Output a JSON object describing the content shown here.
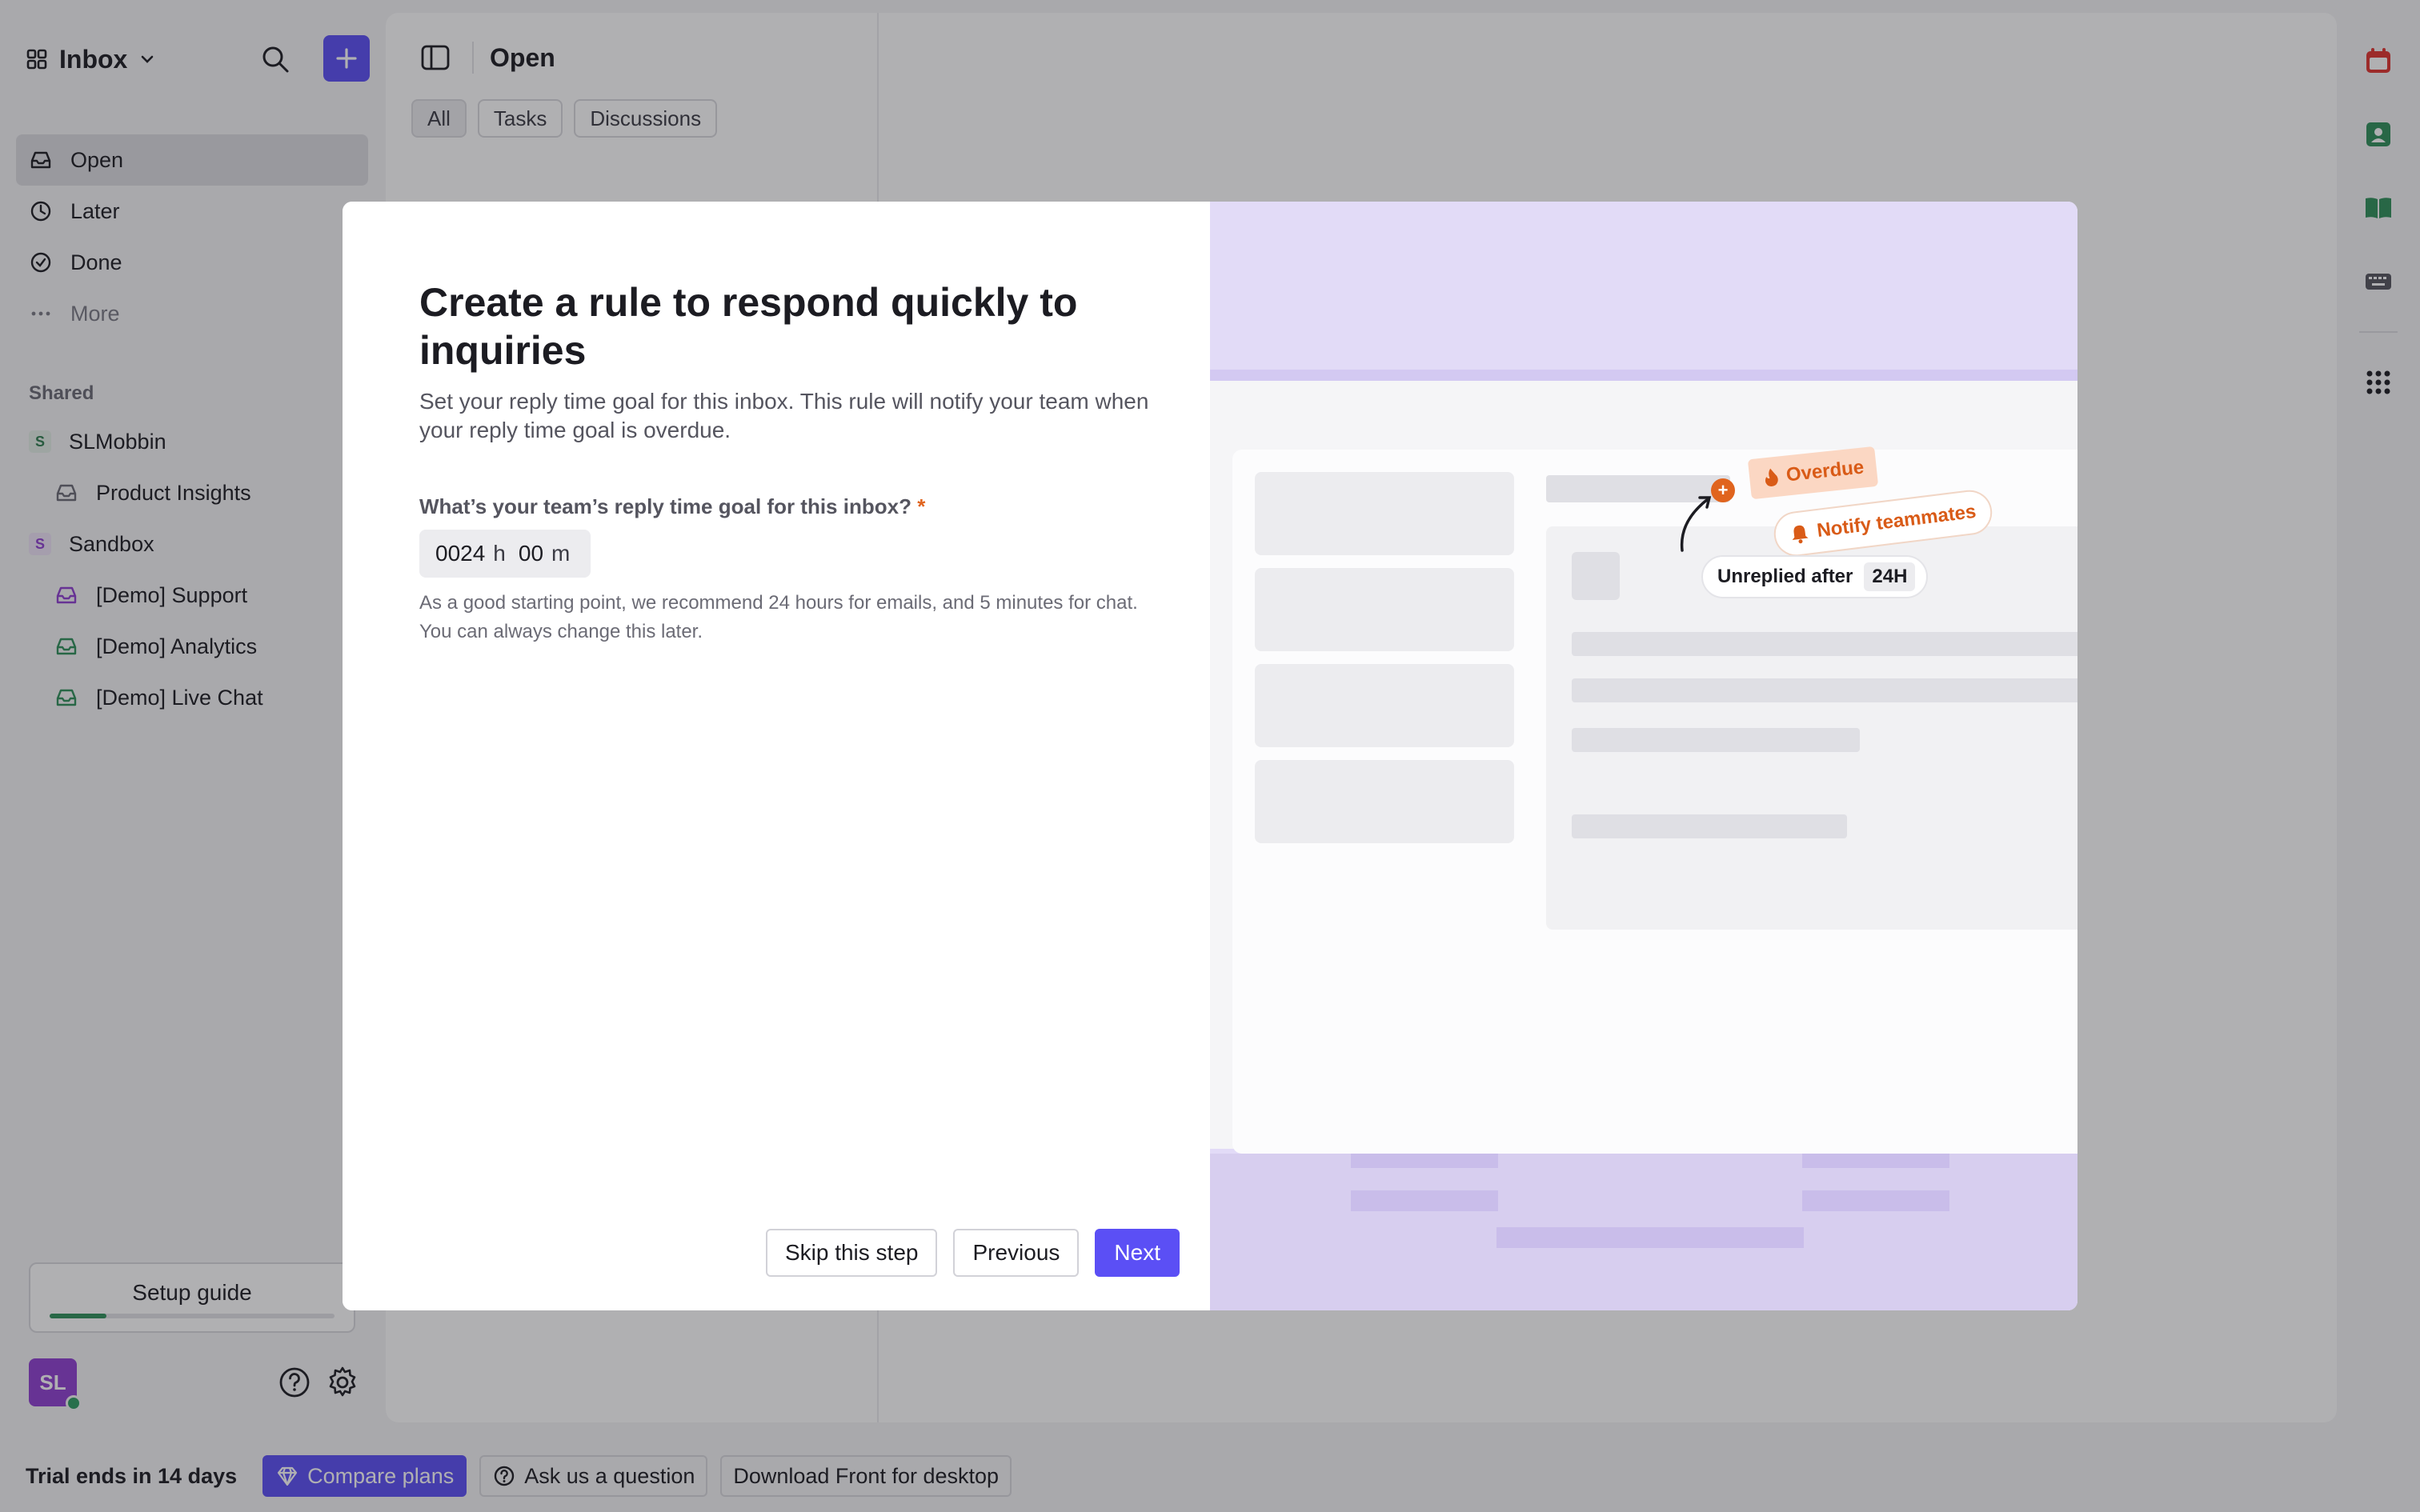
{
  "sidebar": {
    "inbox_title": "Inbox",
    "nav": [
      {
        "label": "Open"
      },
      {
        "label": "Later"
      },
      {
        "label": "Done"
      },
      {
        "label": "More"
      }
    ],
    "shared_label": "Shared",
    "shared": [
      {
        "label": "SLMobbin",
        "badge": "S"
      },
      {
        "label": "Product Insights"
      },
      {
        "label": "Sandbox",
        "badge": "S"
      },
      {
        "label": "[Demo] Support"
      },
      {
        "label": "[Demo] Analytics"
      },
      {
        "label": "[Demo] Live Chat"
      }
    ],
    "setup_guide": "Setup guide",
    "setup_progress": 0.2,
    "avatar_initials": "SL"
  },
  "main": {
    "title": "Open",
    "filters": [
      "All",
      "Tasks",
      "Discussions"
    ]
  },
  "bottombar": {
    "trial": "Trial ends in 14 days",
    "compare": "Compare plans",
    "ask": "Ask us a question",
    "download": "Download Front for desktop"
  },
  "modal": {
    "title": "Create a rule to respond quickly to inquiries",
    "subtitle": "Set your reply time goal for this inbox. This rule will notify your team when your reply time goal is overdue.",
    "field_label": "What’s your team’s reply time goal for this inbox?",
    "required_mark": "*",
    "hours_value": "0024",
    "hours_unit": "h",
    "minutes_value": "00",
    "minutes_unit": "m",
    "help": "As a good starting point, we recommend 24 hours for emails, and 5 minutes for chat. You can always change this later.",
    "skip": "Skip this step",
    "previous": "Previous",
    "next": "Next",
    "illustration": {
      "overdue": "Overdue",
      "notify": "Notify teammates",
      "unreplied": "Unreplied after",
      "unreplied_value": "24H"
    }
  },
  "colors": {
    "accent": "#5b4ff5",
    "warning": "#e0641e",
    "progress": "#2e8f5a"
  }
}
